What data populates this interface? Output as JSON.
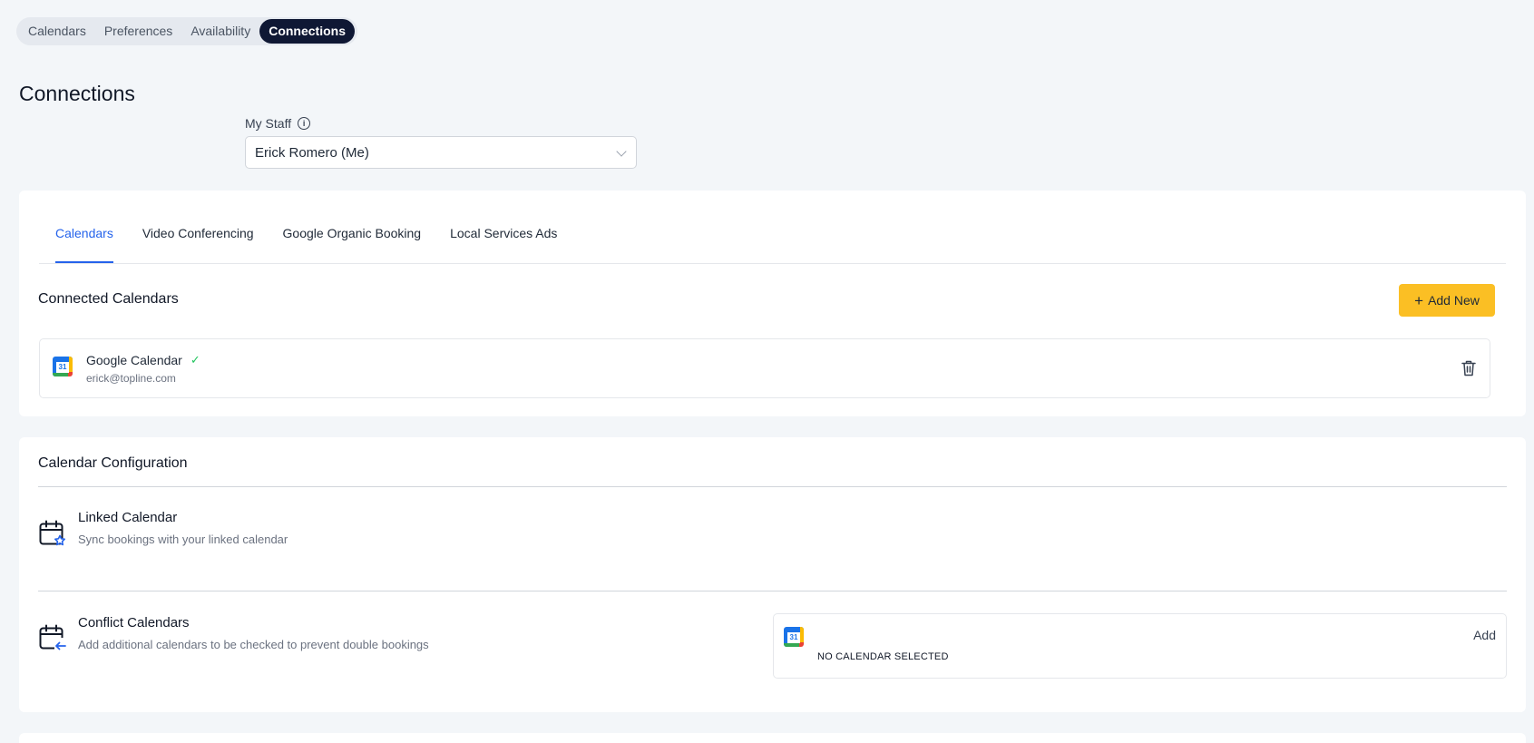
{
  "top_nav": {
    "items": [
      {
        "label": "Calendars",
        "active": false
      },
      {
        "label": "Preferences",
        "active": false
      },
      {
        "label": "Availability",
        "active": false
      },
      {
        "label": "Connections",
        "active": true
      }
    ]
  },
  "page": {
    "title": "Connections"
  },
  "staff": {
    "label": "My Staff",
    "selected": "Erick Romero (Me)"
  },
  "connections_card": {
    "tabs": [
      {
        "label": "Calendars",
        "active": true
      },
      {
        "label": "Video Conferencing",
        "active": false
      },
      {
        "label": "Google Organic Booking",
        "active": false
      },
      {
        "label": "Local Services Ads",
        "active": false
      }
    ],
    "section_title": "Connected Calendars",
    "add_new_label": "Add New",
    "connected": {
      "name": "Google Calendar",
      "email": "erick@topline.com",
      "icon_day": "31"
    }
  },
  "config_card": {
    "title": "Calendar Configuration",
    "linked": {
      "title": "Linked Calendar",
      "description": "Sync bookings with your linked calendar"
    },
    "conflict": {
      "title": "Conflict Calendars",
      "description": "Add additional calendars to be checked to prevent double bookings",
      "add_label": "Add",
      "empty_text": "NO CALENDAR SELECTED",
      "icon_day": "31"
    }
  },
  "colors": {
    "accent": "#2563eb",
    "primary_button": "#fbbf24",
    "active_pill": "#0f1834",
    "success": "#22c55e"
  },
  "icons": {
    "info": "info-icon",
    "chevron": "chevron-down-icon",
    "plus": "plus-icon",
    "check": "check-icon",
    "trash": "trash-icon",
    "linked": "calendar-star-icon",
    "conflict": "calendar-arrow-icon"
  }
}
